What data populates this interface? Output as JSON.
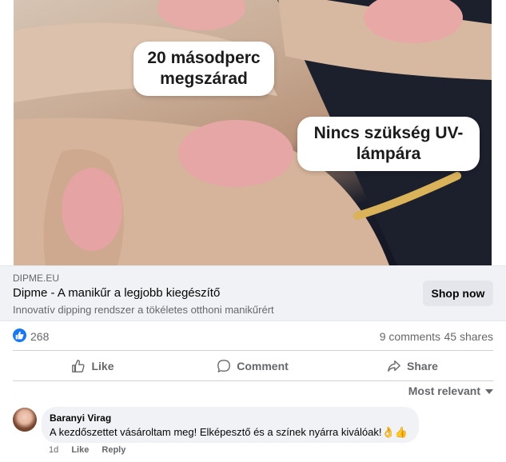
{
  "ad": {
    "callout_1": "20 másodperc megszárad",
    "callout_2": "Nincs szükség UV-lámpára"
  },
  "link_preview": {
    "domain": "DIPME.EU",
    "title": "Dipme - A manikűr a legjobb kiegészítő",
    "description": "Innovatív dipping rendszer a tökéletes otthoni manikűrért",
    "cta_label": "Shop now"
  },
  "stats": {
    "reaction_icon": "like-icon",
    "reactions": "268",
    "comments": "9 comments",
    "shares": "45 shares"
  },
  "actions": {
    "like": "Like",
    "comment": "Comment",
    "share": "Share"
  },
  "sort": {
    "label": "Most relevant"
  },
  "comment": {
    "author": "Baranyi Virag",
    "text": "A kezdőszettet vásároltam meg! Elképesztő és a színek nyárra kiválóak!👌👍",
    "time": "1d",
    "like_label": "Like",
    "reply_label": "Reply"
  },
  "colors": {
    "accent": "#1877f2",
    "secondary_text": "#65676b",
    "link_bar_bg": "#f0f2f5"
  }
}
